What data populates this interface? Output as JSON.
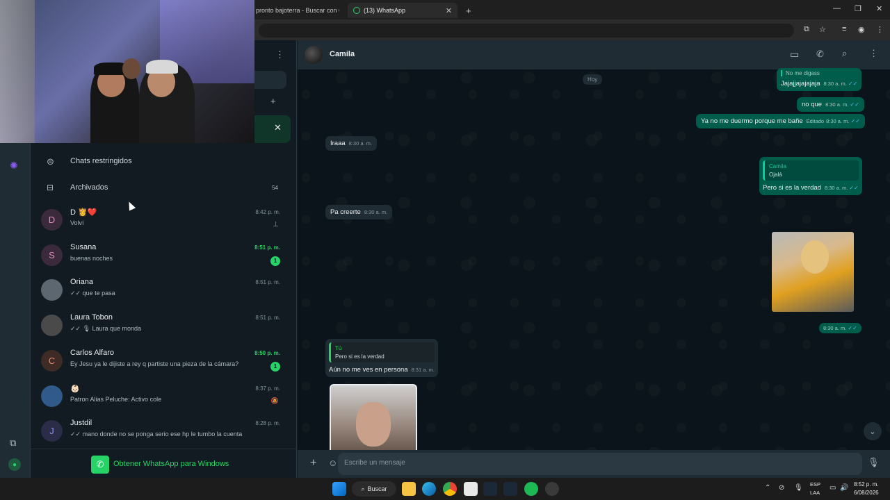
{
  "browser": {
    "tabs": [
      {
        "label": "pronto bajoterra - Buscar con G",
        "active": false
      },
      {
        "label": "(13) WhatsApp",
        "active": true
      }
    ],
    "new_tab": "+",
    "window_controls": [
      "—",
      "❐",
      "✕"
    ]
  },
  "sidebar_top": {
    "restricted_label": "Chats restringidos",
    "archived_label": "Archivados",
    "archived_count": "54"
  },
  "chats": [
    {
      "name": "D 👸❤️",
      "preview": "Volví",
      "time": "8:42 p. m.",
      "unread": false,
      "initial": "D",
      "avatar_color": "#3b2a3b",
      "initial_color": "#e58bc0",
      "side": "pin"
    },
    {
      "name": "Susana",
      "preview": "buenas noches",
      "time": "8:51 p. m.",
      "unread": true,
      "badge": "1",
      "initial": "S",
      "avatar_color": "#3b2a3b",
      "initial_color": "#e58bc0"
    },
    {
      "name": "Oriana",
      "preview": "✓✓ que te pasa",
      "time": "8:51 p. m.",
      "unread": false,
      "initial": "",
      "avatar_color": "#5c6770"
    },
    {
      "name": "Laura Tobon",
      "preview": "✓✓ 🎙 Laura que monda",
      "time": "8:51 p. m.",
      "unread": false,
      "initial": "",
      "avatar_color": "#4a4a4a"
    },
    {
      "name": "Carlos Alfaro",
      "preview": "Ey Jesu ya le dijiste a rey q partiste una pieza de la cámara?",
      "time": "8:50 p. m.",
      "unread": true,
      "badge": "1",
      "initial": "C",
      "avatar_color": "#3e2b26",
      "initial_color": "#f08a6b"
    },
    {
      "name": "👶🏻",
      "preview": "Patron Alias Peluche: Activo cole",
      "time": "8:37 p. m.",
      "unread": false,
      "initial": "",
      "avatar_color": "#2f5a8a",
      "side": "mute"
    },
    {
      "name": "Justdil",
      "preview": "✓✓ mano donde no se ponga serio ese hp le tumbo la cuenta",
      "time": "8:28 p. m.",
      "unread": false,
      "initial": "J",
      "avatar_color": "#2b2c47",
      "initial_color": "#8f93e8"
    }
  ],
  "download_banner": "Obtener WhatsApp para Windows",
  "conversation": {
    "contact_name": "Camila",
    "date_chip": "Hoy",
    "messages": [
      {
        "dir": "out",
        "quote_name": "",
        "quote_text": "No me digass",
        "text": "Jajajjajajajaja",
        "time": "8:30 a. m."
      },
      {
        "dir": "out",
        "text": "no que",
        "time": "8:30 a. m."
      },
      {
        "dir": "out",
        "text": "Ya no me duermo porque me bañe",
        "edited": "Editado",
        "time": "8:30 a. m."
      },
      {
        "dir": "in",
        "text": "Iraaa",
        "time": "8:30 a. m."
      },
      {
        "dir": "out",
        "quote_name": "Camila",
        "quote_text": "Ojalá",
        "text": "Pero si es la verdad",
        "time": "8:30 a. m."
      },
      {
        "dir": "in",
        "text": "Pa creerte",
        "time": "8:30 a. m."
      },
      {
        "dir": "out",
        "image": true,
        "time": "8:30 a. m."
      },
      {
        "dir": "in",
        "quote_name": "Tú",
        "quote_text": "Pero si es la verdad",
        "text": "Aún no me ves en persona",
        "time": "8:31 a. m."
      }
    ],
    "composer_placeholder": "Escribe un mensaje"
  },
  "taskbar": {
    "search_label": "Buscar",
    "lang": "ESP",
    "lang2": "LAA",
    "time": "8:52 p. m.",
    "date": "6/08/2026"
  },
  "colors": {
    "accent": "#25d366",
    "outgoing": "#005c4b",
    "incoming": "#202c33",
    "panel": "#111b21"
  }
}
